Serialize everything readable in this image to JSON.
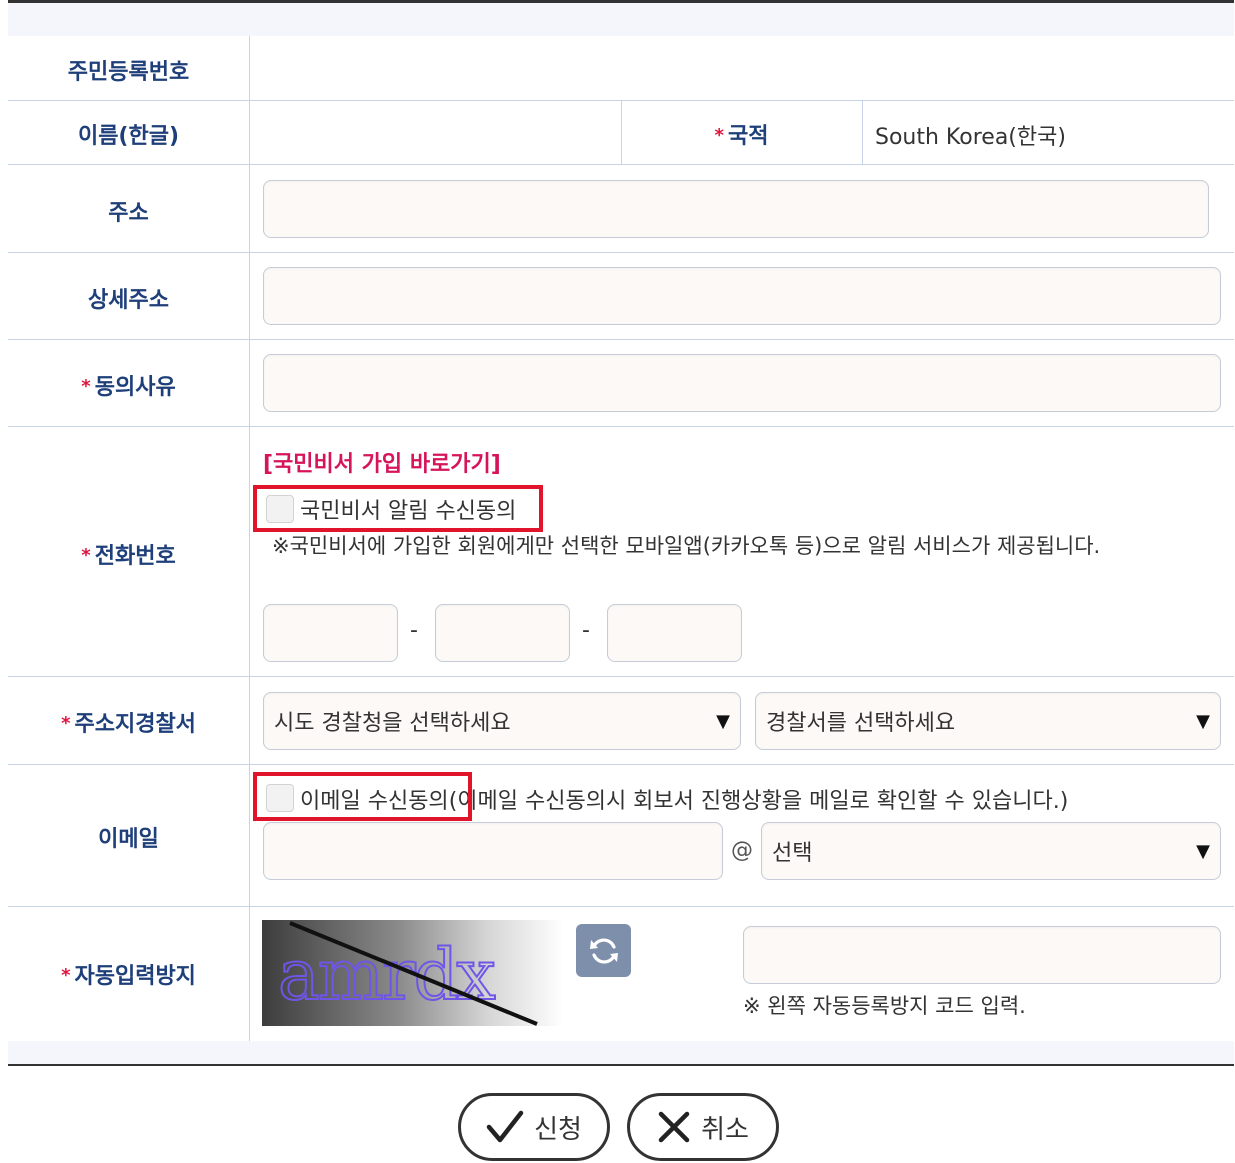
{
  "form": {
    "rrn_label": "주민등록번호",
    "name_label": "이름(한글)",
    "nationality_label": "국적",
    "nationality_value": "South Korea(한국)",
    "address_label": "주소",
    "address_detail_label": "상세주소",
    "consent_reason_label": "동의사유",
    "phone_label": "전화번호",
    "phone_link": "[국민비서 가입 바로가기]",
    "phone_consent_label": "국민비서 알림 수신동의",
    "phone_notice": "※국민비서에 가입한 회원에게만 선택한 모바일앱(카카오톡 등)으로 알림 서비스가 제공됩니다.",
    "phone_separator": "-",
    "police_label": "주소지경찰서",
    "police_agency_placeholder": "시도 경찰청을 선택하세요",
    "police_station_placeholder": "경찰서를 선택하세요",
    "email_label": "이메일",
    "email_consent_label": "이메일 수신동의",
    "email_consent_note": "(이메일 수신동의시 회보서 진행상황을 메일로 확인할 수 있습니다.)",
    "email_at": "@",
    "email_domain_select": "선택",
    "captcha_label": "자동입력방지",
    "captcha_text": "amrdx",
    "captcha_notice": "※ 왼쪽 자동등록방지 코드 입력.",
    "required_mark": "*"
  },
  "buttons": {
    "submit_label": "신청",
    "cancel_label": "취소"
  },
  "colors": {
    "label": "#1e3f7a",
    "required": "#e0143c",
    "link": "#d6145a",
    "highlight_box": "#e0142a",
    "refresh_button": "#7e8fab"
  },
  "icons": {
    "dropdown": "triangle-down",
    "refresh": "refresh-icon",
    "submit": "checkmark-icon",
    "cancel": "x-icon"
  }
}
